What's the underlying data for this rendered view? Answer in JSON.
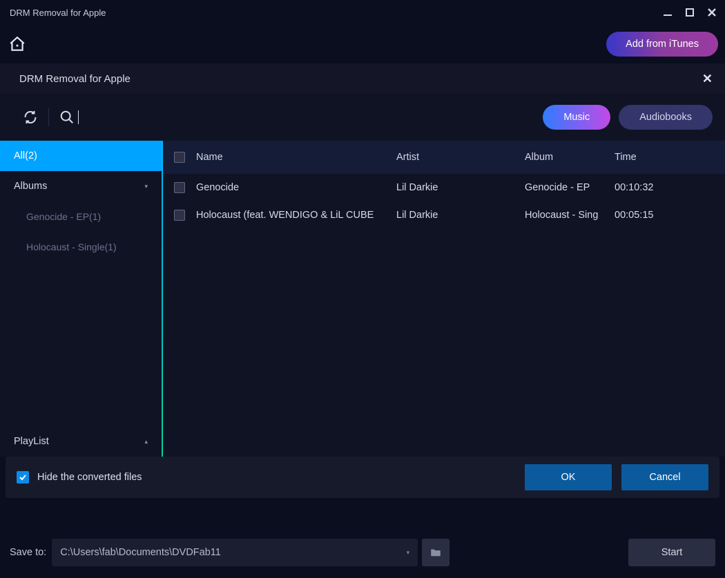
{
  "window": {
    "title": "DRM Removal for Apple"
  },
  "top": {
    "add_itunes": "Add from iTunes"
  },
  "panel": {
    "title": "DRM Removal for Apple"
  },
  "tabs": {
    "music": "Music",
    "audiobooks": "Audiobooks"
  },
  "sidebar": {
    "all": "All(2)",
    "albums": "Albums",
    "items": [
      {
        "label": "Genocide - EP(1)"
      },
      {
        "label": "Holocaust - Single(1)"
      }
    ],
    "playlist": "PlayList"
  },
  "table": {
    "headers": {
      "name": "Name",
      "artist": "Artist",
      "album": "Album",
      "time": "Time"
    },
    "rows": [
      {
        "name": "Genocide",
        "artist": "Lil Darkie",
        "album": "Genocide - EP",
        "time": "00:10:32"
      },
      {
        "name": "Holocaust (feat. WENDIGO & LiL CUBE",
        "artist": "Lil Darkie",
        "album": "Holocaust - Sing",
        "time": "00:05:15"
      }
    ]
  },
  "bottom": {
    "hide_label": "Hide the converted files",
    "ok": "OK",
    "cancel": "Cancel"
  },
  "footer": {
    "save_to": "Save to:",
    "path": "C:\\Users\\fab\\Documents\\DVDFab11",
    "start": "Start"
  }
}
